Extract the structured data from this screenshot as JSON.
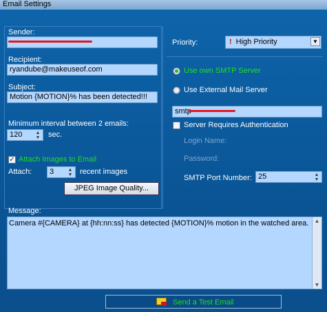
{
  "window": {
    "title": "Email Settings"
  },
  "sender": {
    "label": "Sender:",
    "value": ""
  },
  "recipient": {
    "label": "Recipient:",
    "value": "ryandube@makeuseof.com"
  },
  "subject": {
    "label": "Subject:",
    "value": "Motion {MOTION}% has been detected!!!"
  },
  "interval": {
    "label": "Minimum interval between 2 emails:",
    "value": "120",
    "unit": "sec."
  },
  "attach_images": {
    "label": "Attach Images to Email",
    "checked": true
  },
  "attach": {
    "label": "Attach:",
    "value": "3",
    "suffix": "recent images"
  },
  "jpeg_button": {
    "label": "JPEG Image Quality..."
  },
  "priority": {
    "label": "Priority:",
    "value": "High Priority",
    "mark": "!"
  },
  "smtp_own": {
    "label": "Use own SMTP Server",
    "selected": true
  },
  "smtp_external": {
    "label": "Use External Mail Server",
    "selected": false
  },
  "smtp_field": {
    "value": "smtp"
  },
  "auth": {
    "label": "Server Requires Authentication",
    "checked": false
  },
  "login": {
    "label": "Login Name:"
  },
  "password": {
    "label": "Password:"
  },
  "port": {
    "label": "SMTP Port Number:",
    "value": "25"
  },
  "message": {
    "label": "Message:",
    "value": "Camera #{CAMERA} at {hh:nn:ss} has detected {MOTION}% motion in the watched area."
  },
  "test_button": {
    "label": "Send a Test Email"
  },
  "colors": {
    "background": "#0b5a9e",
    "field": "#b3d7ff",
    "accent_green": "#1ee01e",
    "redaction": "#e8141d"
  }
}
